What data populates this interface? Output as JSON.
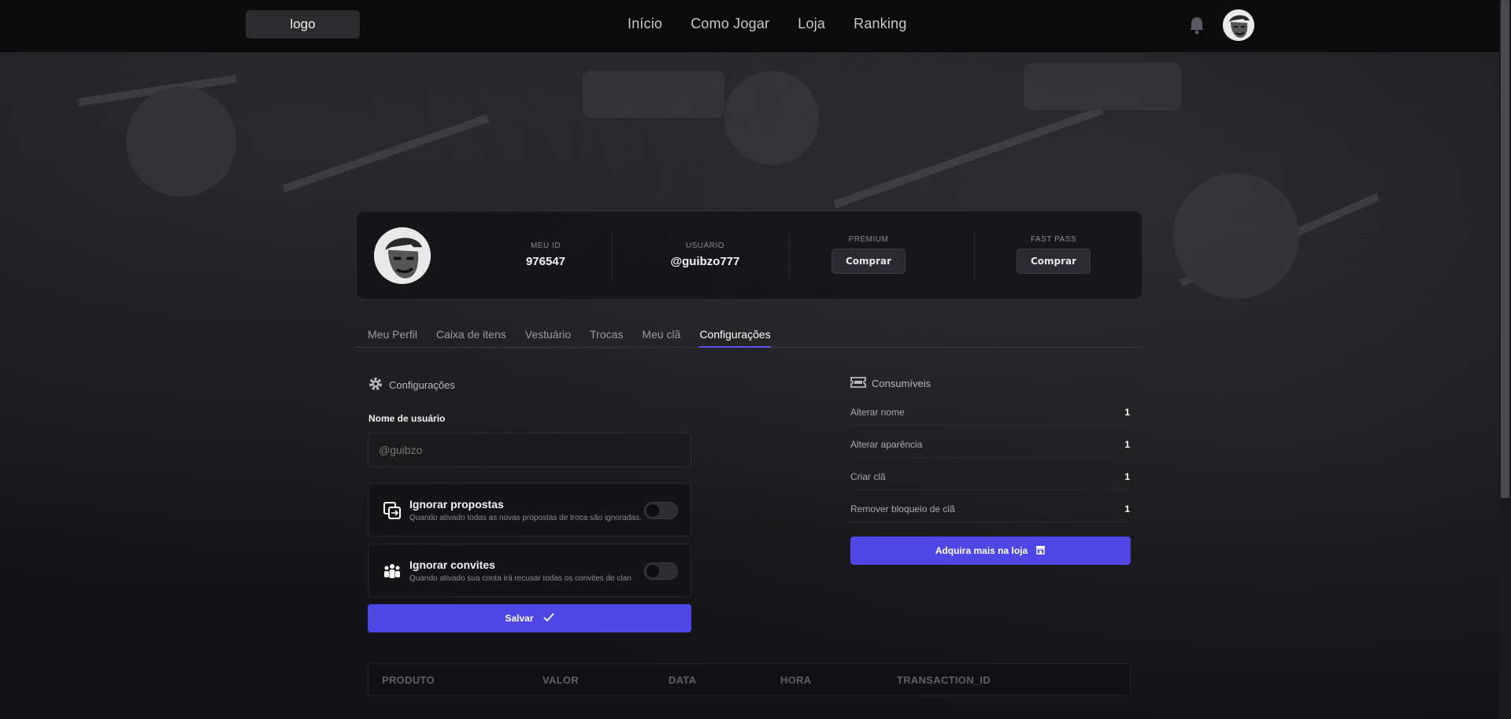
{
  "header": {
    "logo": "logo",
    "nav": [
      "Início",
      "Como Jogar",
      "Loja",
      "Ranking"
    ]
  },
  "profile": {
    "id_label": "MEU ID",
    "id_value": "976547",
    "user_label": "USUÁRIO",
    "user_value": "@guibzo777",
    "premium_label": "PREMIUM",
    "premium_button": "Comprar",
    "fastpass_label": "FAST PASS",
    "fastpass_button": "Comprar"
  },
  "tabs": [
    "Meu Perfil",
    "Caixa de itens",
    "Vestuário",
    "Trocas",
    "Meu clã",
    "Configurações"
  ],
  "active_tab": "Configurações",
  "settings": {
    "title": "Configurações",
    "username_label": "Nome de usuário",
    "username_placeholder": "@guibzo",
    "toggles": [
      {
        "title": "Ignorar propostas",
        "desc": "Quando ativado todas as novas propostas de troca são ignoradas.",
        "on": false
      },
      {
        "title": "Ignorar convites",
        "desc": "Quando ativado sua conta irá recusar todas os convites de clan",
        "on": false
      }
    ],
    "save_label": "Salvar"
  },
  "consumables": {
    "title": "Consumíveis",
    "items": [
      {
        "label": "Alterar nome",
        "value": "1"
      },
      {
        "label": "Alterar aparência",
        "value": "1"
      },
      {
        "label": "Criar clã",
        "value": "1"
      },
      {
        "label": "Remover bloqueio de clã",
        "value": "1"
      }
    ],
    "shop_label": "Adquira mais na loja"
  },
  "table": {
    "headers": [
      "PRODUTO",
      "VALOR",
      "DATA",
      "HORA",
      "TRANSACTION_ID"
    ]
  },
  "colors": {
    "accent": "#4e46e5",
    "background": "#141416"
  }
}
